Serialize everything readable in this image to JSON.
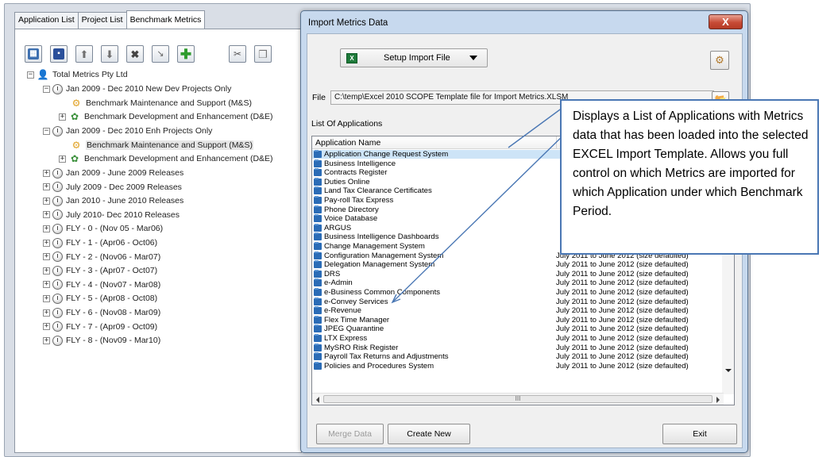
{
  "tabs": [
    "Application List",
    "Project List",
    "Benchmark Metrics"
  ],
  "toolbar": {
    "buttons": [
      "excel-icon",
      "save-icon",
      "move-up-icon",
      "move-down-icon",
      "delete-icon",
      "edit-icon",
      "add-icon",
      "cut-icon",
      "copy-icon"
    ]
  },
  "tree": {
    "root": "Total Metrics Pty Ltd",
    "group1": {
      "label": "Jan 2009 - Dec 2010 New Dev Projects Only",
      "child1": "Benchmark Maintenance and Support (M&S)",
      "child2": "Benchmark Development and Enhancement (D&E)"
    },
    "group2": {
      "label": "Jan 2009 - Dec 2010 Enh Projects Only",
      "child1": "Benchmark Maintenance and Support (M&S)",
      "child2": "Benchmark Development and Enhancement (D&E)"
    },
    "periods": [
      "Jan 2009 - June 2009 Releases",
      "July 2009 - Dec 2009 Releases",
      "Jan 2010 - June 2010 Releases",
      "July 2010- Dec 2010 Releases",
      "FLY - 0 - (Nov 05 - Mar06)",
      "FLY - 1 - (Apr06 - Oct06)",
      "FLY - 2 - (Nov06 - Mar07)",
      "FLY - 3 - (Apr07 - Oct07)",
      "FLY - 4 - (Nov07 - Mar08)",
      "FLY - 5 - (Apr08 - Oct08)",
      "FLY - 6 - (Nov08 - Mar09)",
      "FLY - 7 - (Apr09 - Oct09)",
      "FLY - 8 - (Nov09 - Mar10)"
    ]
  },
  "dialog": {
    "title": "Import Metrics Data",
    "close_label": "X",
    "setup_label": "Setup Import File",
    "file_label": "File",
    "file_path": "C:\\temp\\Excel 2010 SCOPE Template file for Import Metrics.XLSM",
    "apps_label": "List Of Applications",
    "col_name": "Application Name",
    "scroll_grip": "III",
    "merge_label": "Merge Data",
    "create_label": "Create New",
    "exit_label": "Exit",
    "applications": [
      {
        "name": "Application Change Request System",
        "period": ""
      },
      {
        "name": "Business Intelligence",
        "period": ""
      },
      {
        "name": "Contracts Register",
        "period": ""
      },
      {
        "name": "Duties Online",
        "period": ""
      },
      {
        "name": "Land Tax Clearance Certificates",
        "period": ""
      },
      {
        "name": "Pay-roll Tax Express",
        "period": ""
      },
      {
        "name": "Phone Directory",
        "period": ""
      },
      {
        "name": "Voice Database",
        "period": ""
      },
      {
        "name": "ARGUS",
        "period": ""
      },
      {
        "name": "Business Intelligence Dashboards",
        "period": ""
      },
      {
        "name": "Change Management System",
        "period": ""
      },
      {
        "name": "Configuration Management System",
        "period": "July 2011 to June 2012 (size defaulted)"
      },
      {
        "name": "Delegation Management System",
        "period": "July 2011 to June 2012 (size defaulted)"
      },
      {
        "name": "DRS",
        "period": "July 2011 to June 2012 (size defaulted)"
      },
      {
        "name": "e-Admin",
        "period": "July 2011 to June 2012 (size defaulted)"
      },
      {
        "name": "e-Business Common Components",
        "period": "July 2011 to June 2012 (size defaulted)"
      },
      {
        "name": "e-Convey Services",
        "period": "July 2011 to June 2012 (size defaulted)"
      },
      {
        "name": "e-Revenue",
        "period": "July 2011 to June 2012 (size defaulted)"
      },
      {
        "name": "Flex Time Manager",
        "period": "July 2011 to June 2012 (size defaulted)"
      },
      {
        "name": "JPEG Quarantine",
        "period": "July 2011 to June 2012 (size defaulted)"
      },
      {
        "name": "LTX Express",
        "period": "July 2011 to June 2012 (size defaulted)"
      },
      {
        "name": "MySRO Risk Register",
        "period": "July 2011 to June 2012 (size defaulted)"
      },
      {
        "name": "Payroll Tax Returns and Adjustments",
        "period": "July 2011 to June 2012 (size defaulted)"
      },
      {
        "name": "Policies and Procedures System",
        "period": "July 2011 to June 2012 (size defaulted)"
      }
    ]
  },
  "callout": {
    "text": "Displays a List of Applications with Metrics data that has been loaded into the selected EXCEL Import Template.  Allows you full control on which Metrics are imported for which Application under which Benchmark Period."
  },
  "colors": {
    "accent": "#4a77b4",
    "selection": "#cde4f7",
    "close": "#c74b36"
  }
}
